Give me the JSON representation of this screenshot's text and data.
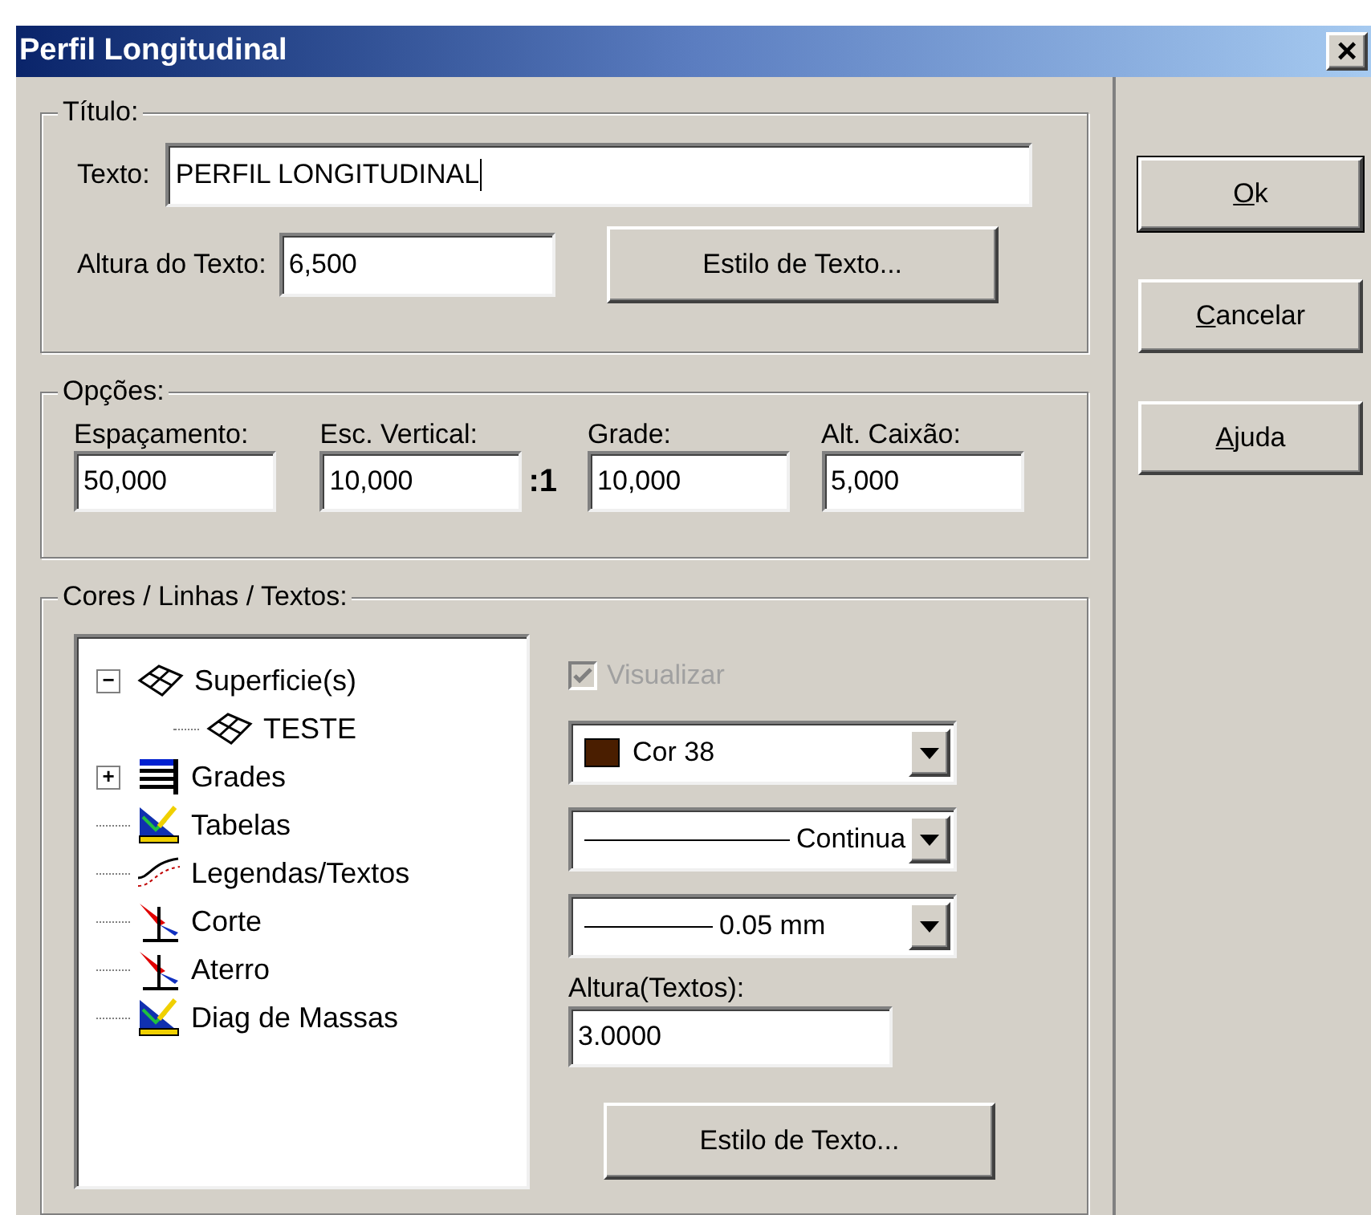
{
  "window": {
    "title": "Perfil Longitudinal",
    "close": "×"
  },
  "titulo": {
    "legend": "Título:",
    "texto_label": "Texto:",
    "texto_value": "PERFIL LONGITUDINAL",
    "texto_focused": true,
    "altura_label": "Altura do Texto:",
    "altura_value": "6,500",
    "style_button": "Estilo de Texto..."
  },
  "opcoes": {
    "legend": "Opções:",
    "fields": [
      {
        "label": "Espaçamento:",
        "value": "50,000"
      },
      {
        "label": "Esc. Vertical:",
        "value": "10,000",
        "suffix": ":1"
      },
      {
        "label": "Grade:",
        "value": "10,000"
      },
      {
        "label": "Alt. Caixão:",
        "value": "5,000"
      }
    ]
  },
  "cores": {
    "legend": "Cores / Linhas / Textos:",
    "tree": [
      {
        "label": "Superficie(s)",
        "kind": "surface",
        "toggle": "−",
        "children": [
          {
            "label": "TESTE",
            "kind": "surface"
          }
        ]
      },
      {
        "label": "Grades",
        "kind": "grid",
        "toggle": "+"
      },
      {
        "label": "Tabelas",
        "kind": "table"
      },
      {
        "label": "Legendas/Textos",
        "kind": "legend"
      },
      {
        "label": "Corte",
        "kind": "section"
      },
      {
        "label": "Aterro",
        "kind": "section"
      },
      {
        "label": "Diag de Massas",
        "kind": "table"
      }
    ],
    "visualizar": {
      "label": "Visualizar",
      "checked": true,
      "disabled": true
    },
    "combos": [
      {
        "kind": "color",
        "value": "Cor 38",
        "color": "#4a1e00"
      },
      {
        "kind": "line",
        "value": "Continua"
      },
      {
        "kind": "weight",
        "value": "0.05 mm"
      }
    ],
    "altura_label": "Altura(Textos):",
    "altura_value": "3.0000",
    "style_button": "Estilo de Texto..."
  },
  "buttons": [
    {
      "label": "Ok",
      "mnemonic": true
    },
    {
      "label": "Cancelar",
      "mnemonic": true
    },
    {
      "label": "Ajuda",
      "mnemonic": true
    }
  ]
}
